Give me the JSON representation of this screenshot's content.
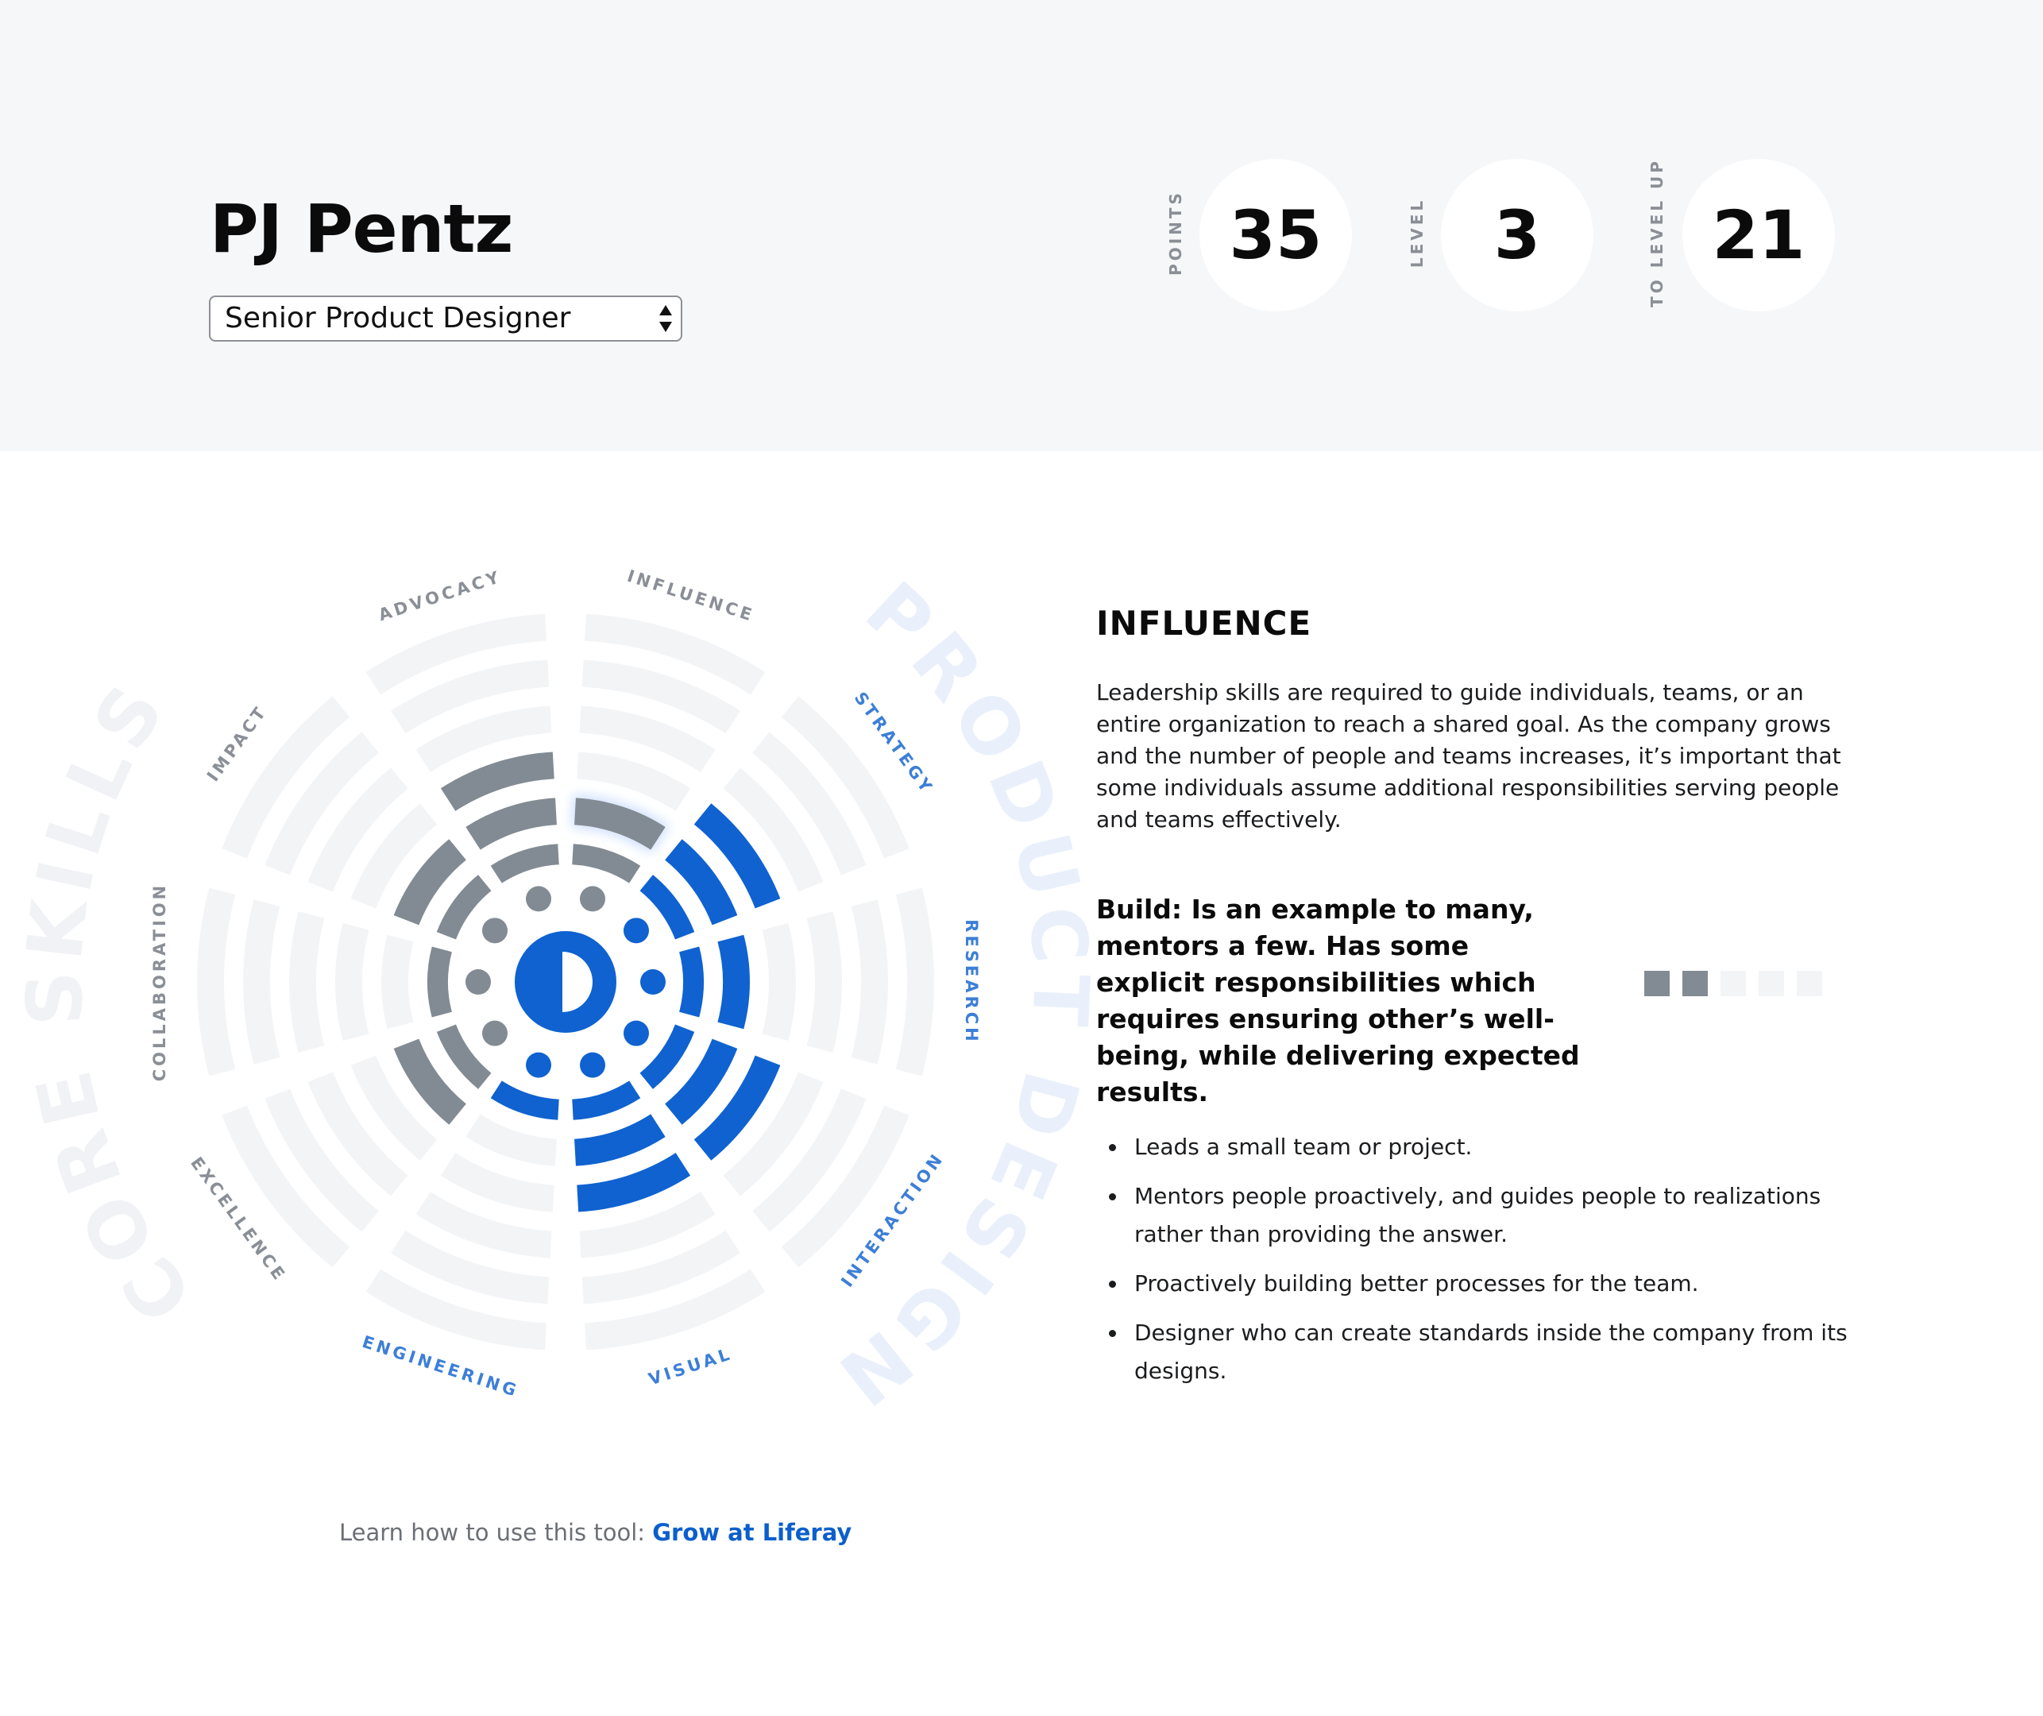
{
  "header": {
    "name": "PJ Pentz",
    "role_select": {
      "value": "Senior Product Designer"
    },
    "stats": [
      {
        "label": "POINTS",
        "value": "35"
      },
      {
        "label": "LEVEL",
        "value": "3"
      },
      {
        "label": "TO LEVEL UP",
        "value": "21"
      }
    ]
  },
  "wheel": {
    "group_labels": {
      "left": "CORE SKILLS",
      "right": "PRODUCT DESIGN"
    },
    "colors": {
      "core_filled": "#828b93",
      "design_filled": "#0f62d0",
      "empty": "#f3f4f6",
      "selected_glow": "#cfe0ff"
    },
    "skills": [
      {
        "name": "INFLUENCE",
        "group": "core",
        "level": 2,
        "selected": true
      },
      {
        "name": "STRATEGY",
        "group": "design",
        "level": 3
      },
      {
        "name": "RESEARCH",
        "group": "design",
        "level": 2
      },
      {
        "name": "INTERACTION",
        "group": "design",
        "level": 3
      },
      {
        "name": "VISUAL",
        "group": "design",
        "level": 3
      },
      {
        "name": "ENGINEERING",
        "group": "design",
        "level": 1
      },
      {
        "name": "EXCELLENCE",
        "group": "core",
        "level": 2
      },
      {
        "name": "COLLABORATION",
        "group": "core",
        "level": 1
      },
      {
        "name": "IMPACT",
        "group": "core",
        "level": 2
      },
      {
        "name": "ADVOCACY",
        "group": "core",
        "level": 3
      }
    ]
  },
  "detail": {
    "title": "INFLUENCE",
    "description": "Leadership skills are required to guide individuals, teams, or an entire organization to reach a shared goal. As the company grows and the number of people and teams increases, it’s important that some individuals assume additional responsibilities serving people and teams effectively.",
    "build_text": "Build: Is an example to many, mentors a few. Has some explicit responsibilities which requires ensuring other’s well-being, while delivering expected results.",
    "level_squares": {
      "filled": 2,
      "total": 5
    },
    "bullets": [
      "Leads a small team or project.",
      "Mentors people proactively, and guides people to realizations rather than providing the answer.",
      "Proactively building better processes for the team.",
      "Designer who can create standards inside the company from its designs."
    ]
  },
  "footer": {
    "prefix": "Learn how to use this tool: ",
    "link_text": "Grow at Liferay"
  }
}
